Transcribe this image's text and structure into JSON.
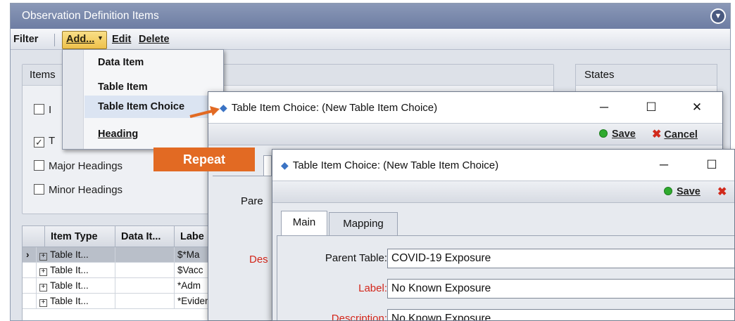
{
  "main": {
    "title": "Observation Definition Items",
    "toolbar": {
      "filter": "Filter",
      "add": "Add...",
      "edit": "Edit",
      "delete": "Delete"
    },
    "items_panel": {
      "title": "Items",
      "checkbox_first": "I",
      "checkbox_second": "T",
      "major_headings": "Major Headings",
      "minor_headings": "Minor Headings"
    },
    "states_panel": {
      "title": "States"
    },
    "grid": {
      "columns": [
        "Item Type",
        "Data It...",
        "Labe"
      ],
      "rows": [
        {
          "type": "Table It...",
          "data": "",
          "label": "$*Ma"
        },
        {
          "type": "Table It...",
          "data": "",
          "label": "$Vacc"
        },
        {
          "type": "Table It...",
          "data": "",
          "label": "*Adm"
        },
        {
          "type": "Table It...",
          "data": "",
          "label": "*Evidence of Imm"
        }
      ]
    }
  },
  "add_menu": {
    "items": [
      {
        "label": "Data Item"
      },
      {
        "label": "Table Item"
      },
      {
        "label": "Table Item Choice"
      },
      {
        "label": "Heading"
      }
    ]
  },
  "annotation": {
    "repeat": "Repeat"
  },
  "dialog1": {
    "title": "Table Item Choice: (New Table Item Choice)",
    "save": "Save",
    "cancel": "Cancel",
    "partial_parent": "Pare",
    "partial_desc": "Des"
  },
  "dialog2": {
    "title": "Table Item Choice: (New Table Item Choice)",
    "save": "Save",
    "tabs": [
      "Main",
      "Mapping"
    ],
    "fields": {
      "parent_table_label": "Parent Table:",
      "parent_table_value": "COVID-19 Exposure",
      "label_label": "Label:",
      "label_value": "No Known Exposure",
      "description_label": "Description:",
      "description_value": "No Known Exposure"
    }
  },
  "colors": {
    "accent_orange": "#e26a23",
    "title_blue": "#7282a9",
    "required_red": "#d3261a"
  }
}
